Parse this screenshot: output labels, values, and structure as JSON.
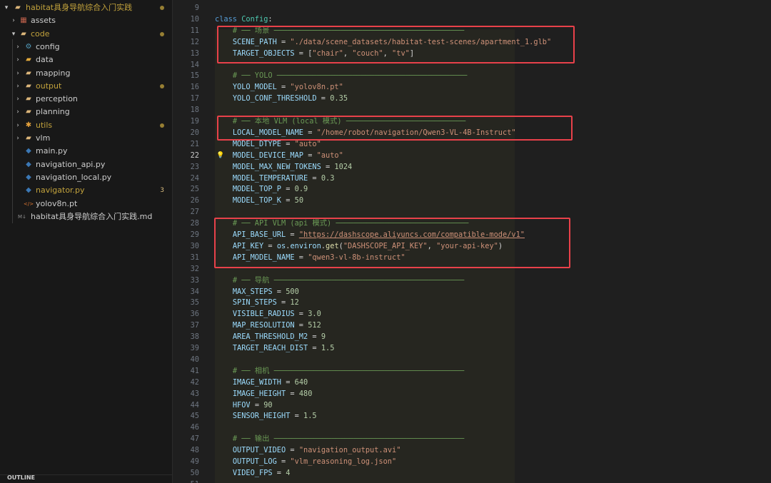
{
  "colors": {
    "modified": "#c2a23c",
    "badge": "#d7ba7d",
    "highlight_box": "#e8414a",
    "comment": "#6a9955",
    "string": "#ce9178",
    "number": "#b5cea8",
    "variable": "#9cdcfe"
  },
  "explorer": {
    "items": [
      {
        "label": "habitat具身导航综合入门实践",
        "icon": "folder-open-icon",
        "glyph": "▰",
        "icon_color": "#dcb67a",
        "chevron": "▾",
        "level": 0,
        "color": "#c2a23c",
        "dot": true
      },
      {
        "label": "assets",
        "icon": "assets-folder-icon",
        "glyph": "▦",
        "icon_color": "#c0614c",
        "chevron": "›",
        "level": 1,
        "color": "#cccccc"
      },
      {
        "label": "code",
        "icon": "folder-open-icon",
        "glyph": "▰",
        "icon_color": "#dcb67a",
        "chevron": "▾",
        "level": 1,
        "color": "#c2a23c",
        "dot": true
      },
      {
        "label": "config",
        "icon": "config-folder-icon",
        "glyph": "⚙",
        "icon_color": "#519aba",
        "chevron": "›",
        "level": 2,
        "color": "#cccccc"
      },
      {
        "label": "data",
        "icon": "data-folder-icon",
        "glyph": "▰",
        "icon_color": "#e2a93b",
        "chevron": "›",
        "level": 2,
        "color": "#cccccc"
      },
      {
        "label": "mapping",
        "icon": "folder-icon",
        "glyph": "▰",
        "icon_color": "#dcb67a",
        "chevron": "›",
        "level": 2,
        "color": "#cccccc"
      },
      {
        "label": "output",
        "icon": "folder-icon",
        "glyph": "▰",
        "icon_color": "#dcb67a",
        "chevron": "›",
        "level": 2,
        "color": "#c2a23c",
        "dot": true
      },
      {
        "label": "perception",
        "icon": "folder-icon",
        "glyph": "▰",
        "icon_color": "#dcb67a",
        "chevron": "›",
        "level": 2,
        "color": "#cccccc"
      },
      {
        "label": "planning",
        "icon": "folder-icon",
        "glyph": "▰",
        "icon_color": "#dcb67a",
        "chevron": "›",
        "level": 2,
        "color": "#cccccc"
      },
      {
        "label": "utils",
        "icon": "utils-folder-icon",
        "glyph": "✱",
        "icon_color": "#e8a33c",
        "chevron": "›",
        "level": 2,
        "color": "#c2a23c",
        "dot": true
      },
      {
        "label": "vlm",
        "icon": "folder-icon",
        "glyph": "▰",
        "icon_color": "#dcb67a",
        "chevron": "›",
        "level": 2,
        "color": "#cccccc"
      },
      {
        "label": "main.py",
        "icon": "python-file-icon",
        "glyph": "◆",
        "icon_color": "#3b78b5",
        "level": 2,
        "color": "#cccccc"
      },
      {
        "label": "navigation_api.py",
        "icon": "python-file-icon",
        "glyph": "◆",
        "icon_color": "#3b78b5",
        "level": 2,
        "color": "#cccccc"
      },
      {
        "label": "navigation_local.py",
        "icon": "python-file-icon",
        "glyph": "◆",
        "icon_color": "#3b78b5",
        "level": 2,
        "color": "#cccccc"
      },
      {
        "label": "navigator.py",
        "icon": "python-file-icon",
        "glyph": "◆",
        "icon_color": "#3b78b5",
        "level": 2,
        "color": "#c2a23c",
        "badge": "3"
      },
      {
        "label": "yolov8n.pt",
        "icon": "code-file-icon",
        "glyph": "</>",
        "icon_color": "#e37933",
        "level": 2,
        "color": "#cccccc"
      },
      {
        "label": "habitat具身导航综合入门实践.md",
        "icon": "markdown-file-icon",
        "glyph": "M↓",
        "icon_color": "#8e8e8e",
        "level": 1,
        "color": "#cccccc"
      }
    ],
    "outline_label": "OUTLINE"
  },
  "editor": {
    "active_line": 22,
    "code_lines": [
      {
        "n": 9,
        "tokens": []
      },
      {
        "n": 10,
        "tokens": [
          [
            "class ",
            "kw"
          ],
          [
            "Config",
            "cls"
          ],
          [
            ":",
            "plain"
          ]
        ]
      },
      {
        "n": 11,
        "tokens": [
          [
            "    ",
            "plain"
          ],
          [
            "# ── 场景 ───────────────────────────────────────────",
            "com"
          ]
        ]
      },
      {
        "n": 12,
        "tokens": [
          [
            "    ",
            "plain"
          ],
          [
            "SCENE_PATH",
            "var"
          ],
          [
            " = ",
            "op"
          ],
          [
            "\"./data/scene_datasets/habitat-test-scenes/apartment_1.glb\"",
            "str"
          ]
        ]
      },
      {
        "n": 13,
        "tokens": [
          [
            "    ",
            "plain"
          ],
          [
            "TARGET_OBJECTS",
            "var"
          ],
          [
            " = [",
            "op"
          ],
          [
            "\"chair\"",
            "str"
          ],
          [
            ", ",
            "op"
          ],
          [
            "\"couch\"",
            "str"
          ],
          [
            ", ",
            "op"
          ],
          [
            "\"tv\"",
            "str"
          ],
          [
            "]",
            "op"
          ]
        ]
      },
      {
        "n": 14,
        "tokens": []
      },
      {
        "n": 15,
        "tokens": [
          [
            "    ",
            "plain"
          ],
          [
            "# ── YOLO ───────────────────────────────────────────",
            "com"
          ]
        ]
      },
      {
        "n": 16,
        "tokens": [
          [
            "    ",
            "plain"
          ],
          [
            "YOLO_MODEL",
            "var"
          ],
          [
            " = ",
            "op"
          ],
          [
            "\"yolov8n.pt\"",
            "str"
          ]
        ]
      },
      {
        "n": 17,
        "tokens": [
          [
            "    ",
            "plain"
          ],
          [
            "YOLO_CONF_THRESHOLD",
            "var"
          ],
          [
            " = ",
            "op"
          ],
          [
            "0.35",
            "num"
          ]
        ]
      },
      {
        "n": 18,
        "tokens": []
      },
      {
        "n": 19,
        "tokens": [
          [
            "    ",
            "plain"
          ],
          [
            "# ── 本地 VLM (local 模式) ───────────────────────────",
            "com"
          ]
        ]
      },
      {
        "n": 20,
        "tokens": [
          [
            "    ",
            "plain"
          ],
          [
            "LOCAL_MODEL_NAME",
            "var"
          ],
          [
            " = ",
            "op"
          ],
          [
            "\"/home/robot/navigation/Qwen3-VL-4B-Instruct\"",
            "str"
          ]
        ]
      },
      {
        "n": 21,
        "tokens": [
          [
            "    ",
            "plain"
          ],
          [
            "MODEL_DTYPE",
            "var"
          ],
          [
            " = ",
            "op"
          ],
          [
            "\"auto\"",
            "str"
          ]
        ]
      },
      {
        "n": 22,
        "tokens": [
          [
            "    ",
            "plain"
          ],
          [
            "MODEL_DEVICE_MAP",
            "var"
          ],
          [
            " = ",
            "op"
          ],
          [
            "\"auto\"",
            "str"
          ]
        ],
        "bulb": true
      },
      {
        "n": 23,
        "tokens": [
          [
            "    ",
            "plain"
          ],
          [
            "MODEL_MAX_NEW_TOKENS",
            "var"
          ],
          [
            " = ",
            "op"
          ],
          [
            "1024",
            "num"
          ]
        ]
      },
      {
        "n": 24,
        "tokens": [
          [
            "    ",
            "plain"
          ],
          [
            "MODEL_TEMPERATURE",
            "var"
          ],
          [
            " = ",
            "op"
          ],
          [
            "0.3",
            "num"
          ]
        ]
      },
      {
        "n": 25,
        "tokens": [
          [
            "    ",
            "plain"
          ],
          [
            "MODEL_TOP_P",
            "var"
          ],
          [
            " = ",
            "op"
          ],
          [
            "0.9",
            "num"
          ]
        ]
      },
      {
        "n": 26,
        "tokens": [
          [
            "    ",
            "plain"
          ],
          [
            "MODEL_TOP_K",
            "var"
          ],
          [
            " = ",
            "op"
          ],
          [
            "50",
            "num"
          ]
        ]
      },
      {
        "n": 27,
        "tokens": []
      },
      {
        "n": 28,
        "tokens": [
          [
            "    ",
            "plain"
          ],
          [
            "# ── API VLM (api 模式) ──────────────────────────────",
            "com"
          ]
        ]
      },
      {
        "n": 29,
        "tokens": [
          [
            "    ",
            "plain"
          ],
          [
            "API_BASE_URL",
            "var"
          ],
          [
            " = ",
            "op"
          ],
          [
            "\"https://dashscope.aliyuncs.com/compatible-mode/v1\"",
            "str-u"
          ]
        ]
      },
      {
        "n": 30,
        "tokens": [
          [
            "    ",
            "plain"
          ],
          [
            "API_KEY",
            "var"
          ],
          [
            " = ",
            "op"
          ],
          [
            "os",
            "var"
          ],
          [
            ".",
            "op"
          ],
          [
            "environ",
            "var"
          ],
          [
            ".",
            "op"
          ],
          [
            "get",
            "fn"
          ],
          [
            "(",
            "op"
          ],
          [
            "\"DASHSCOPE_API_KEY\"",
            "str"
          ],
          [
            ", ",
            "op"
          ],
          [
            "\"your-api-key\"",
            "str"
          ],
          [
            ")",
            "op"
          ]
        ]
      },
      {
        "n": 31,
        "tokens": [
          [
            "    ",
            "plain"
          ],
          [
            "API_MODEL_NAME",
            "var"
          ],
          [
            " = ",
            "op"
          ],
          [
            "\"qwen3-vl-8b-instruct\"",
            "str"
          ]
        ]
      },
      {
        "n": 32,
        "tokens": []
      },
      {
        "n": 33,
        "tokens": [
          [
            "    ",
            "plain"
          ],
          [
            "# ── 导航 ───────────────────────────────────────────",
            "com"
          ]
        ]
      },
      {
        "n": 34,
        "tokens": [
          [
            "    ",
            "plain"
          ],
          [
            "MAX_STEPS",
            "var"
          ],
          [
            " = ",
            "op"
          ],
          [
            "500",
            "num"
          ]
        ]
      },
      {
        "n": 35,
        "tokens": [
          [
            "    ",
            "plain"
          ],
          [
            "SPIN_STEPS",
            "var"
          ],
          [
            " = ",
            "op"
          ],
          [
            "12",
            "num"
          ]
        ]
      },
      {
        "n": 36,
        "tokens": [
          [
            "    ",
            "plain"
          ],
          [
            "VISIBLE_RADIUS",
            "var"
          ],
          [
            " = ",
            "op"
          ],
          [
            "3.0",
            "num"
          ]
        ]
      },
      {
        "n": 37,
        "tokens": [
          [
            "    ",
            "plain"
          ],
          [
            "MAP_RESOLUTION",
            "var"
          ],
          [
            " = ",
            "op"
          ],
          [
            "512",
            "num"
          ]
        ]
      },
      {
        "n": 38,
        "tokens": [
          [
            "    ",
            "plain"
          ],
          [
            "AREA_THRESHOLD_M2",
            "var"
          ],
          [
            " = ",
            "op"
          ],
          [
            "9",
            "num"
          ]
        ]
      },
      {
        "n": 39,
        "tokens": [
          [
            "    ",
            "plain"
          ],
          [
            "TARGET_REACH_DIST",
            "var"
          ],
          [
            " = ",
            "op"
          ],
          [
            "1.5",
            "num"
          ]
        ]
      },
      {
        "n": 40,
        "tokens": []
      },
      {
        "n": 41,
        "tokens": [
          [
            "    ",
            "plain"
          ],
          [
            "# ── 相机 ───────────────────────────────────────────",
            "com"
          ]
        ]
      },
      {
        "n": 42,
        "tokens": [
          [
            "    ",
            "plain"
          ],
          [
            "IMAGE_WIDTH",
            "var"
          ],
          [
            " = ",
            "op"
          ],
          [
            "640",
            "num"
          ]
        ]
      },
      {
        "n": 43,
        "tokens": [
          [
            "    ",
            "plain"
          ],
          [
            "IMAGE_HEIGHT",
            "var"
          ],
          [
            " = ",
            "op"
          ],
          [
            "480",
            "num"
          ]
        ]
      },
      {
        "n": 44,
        "tokens": [
          [
            "    ",
            "plain"
          ],
          [
            "HFOV",
            "var"
          ],
          [
            " = ",
            "op"
          ],
          [
            "90",
            "num"
          ]
        ]
      },
      {
        "n": 45,
        "tokens": [
          [
            "    ",
            "plain"
          ],
          [
            "SENSOR_HEIGHT",
            "var"
          ],
          [
            " = ",
            "op"
          ],
          [
            "1.5",
            "num"
          ]
        ]
      },
      {
        "n": 46,
        "tokens": []
      },
      {
        "n": 47,
        "tokens": [
          [
            "    ",
            "plain"
          ],
          [
            "# ── 输出 ───────────────────────────────────────────",
            "com"
          ]
        ]
      },
      {
        "n": 48,
        "tokens": [
          [
            "    ",
            "plain"
          ],
          [
            "OUTPUT_VIDEO",
            "var"
          ],
          [
            " = ",
            "op"
          ],
          [
            "\"navigation_output.avi\"",
            "str"
          ]
        ]
      },
      {
        "n": 49,
        "tokens": [
          [
            "    ",
            "plain"
          ],
          [
            "OUTPUT_LOG",
            "var"
          ],
          [
            " = ",
            "op"
          ],
          [
            "\"vlm_reasoning_log.json\"",
            "str"
          ]
        ]
      },
      {
        "n": 50,
        "tokens": [
          [
            "    ",
            "plain"
          ],
          [
            "VIDEO_FPS",
            "var"
          ],
          [
            " = ",
            "op"
          ],
          [
            "4",
            "num"
          ]
        ]
      },
      {
        "n": 51,
        "tokens": []
      }
    ]
  }
}
